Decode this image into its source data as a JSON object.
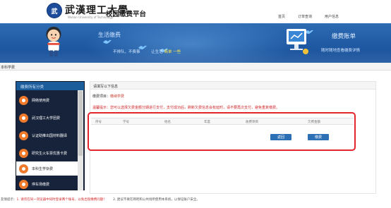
{
  "header": {
    "logo_glyph": "武",
    "school_name": "武漢理工大學",
    "school_name_en": "Wuhan University of Technology",
    "system_title": "校园缴费平台",
    "nav": [
      "首页",
      "订单查询",
      "用户信息"
    ]
  },
  "banner": {
    "left_title": "生活缴费",
    "slogan_prefix": "不排队，不费事",
    "slogan_mid": "让生活",
    "slogan_highlight": "简单",
    "slogan_suffix": "一些",
    "right_title": "缴费账单",
    "right_subtitle": "随时随地查看缴费详情"
  },
  "breadcrumb": "本科学费",
  "sidebar": {
    "header": "缴费所有分类",
    "items": [
      {
        "label": "网络使用费"
      },
      {
        "label": "武汉理工大学团费"
      },
      {
        "label": "认证助推出国材料翻译"
      },
      {
        "label": "研究生火车票优惠卡费"
      },
      {
        "label": "本科生学杂费",
        "active": true
      },
      {
        "label": "停车场缴费"
      }
    ]
  },
  "main": {
    "section_title": "请填写以下信息",
    "project_label": "缴费项目：",
    "project_value": "缴纳学费",
    "warning": "温馨提示：您可以选择欠费金额分期进行支付，支付成功后，刷新欠费信息会有延时，请不要再次支付，避免重复缴费。",
    "columns": [
      "序号",
      "学号",
      "姓名",
      "年度",
      "收费项目",
      "欠费金额"
    ],
    "buttons": {
      "back": "返回",
      "pay": "缴费"
    }
  },
  "footer": {
    "prefix": "友情提示：",
    "tip1": "1. 请勿在同一浏览器中同时登录两个账号，以免出现缴费问题！",
    "tip2": "2. 建议不要在网吧和公共场所使用本系统，以保证账户安全。"
  },
  "colors": {
    "banner_blue": "#1f5aa3",
    "sidebar_dark": "#17233b",
    "icon_orange": "#f07a2b",
    "warning_red": "#d0262a",
    "button_blue": "#2d6fb5"
  }
}
